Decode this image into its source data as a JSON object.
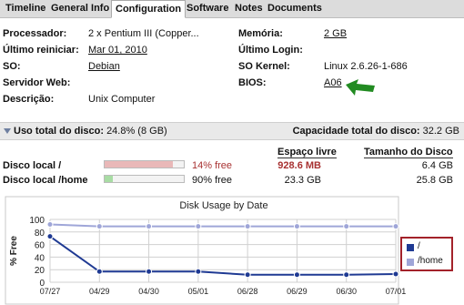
{
  "tabs": [
    {
      "label": "Timeline",
      "active": false
    },
    {
      "label": "General Info",
      "active": false
    },
    {
      "label": "Configuration",
      "active": true
    },
    {
      "label": "Software",
      "active": false
    },
    {
      "label": "Notes",
      "active": false
    },
    {
      "label": "Documents",
      "active": false
    }
  ],
  "info": {
    "processador_label": "Processador:",
    "processador_value": "2 x Pentium III (Copper...",
    "ultimo_reiniciar_label": "Último reiniciar:",
    "ultimo_reiniciar_value": "Mar 01, 2010",
    "so_label": "SO:",
    "so_value": "Debian",
    "servidor_web_label": "Servidor Web:",
    "servidor_web_value": "",
    "descricao_label": "Descrição:",
    "descricao_value": "Unix Computer",
    "memoria_label": "Memória:",
    "memoria_value": "2 GB",
    "ultimo_login_label": "Último Login:",
    "ultimo_login_value": "",
    "so_kernel_label": "SO Kernel:",
    "so_kernel_value": "Linux 2.6.26-1-686",
    "bios_label": "BIOS:",
    "bios_value": "A06"
  },
  "disk_section": {
    "title": "Uso total do disco:",
    "usage": "24.8% (8 GB)",
    "capacity_label": "Capacidade total do disco:",
    "capacity_value": "32.2 GB",
    "col_free": "Espaço livre",
    "col_size": "Tamanho do Disco",
    "disks": [
      {
        "name": "Disco local /",
        "pct_free": "14% free",
        "pct_fill": 0.86,
        "free_value": "928.6 MB",
        "size_value": "6.4 GB",
        "bar_color": "#e9b8b8",
        "pct_color": "#a83232"
      },
      {
        "name": "Disco local /home",
        "pct_free": "90% free",
        "pct_fill": 0.1,
        "free_value": "23.3 GB",
        "size_value": "25.8 GB",
        "bar_color": "#a8dca4",
        "pct_color": "#111111"
      }
    ]
  },
  "chart_data": {
    "type": "line",
    "title": "Disk Usage by Date",
    "ylabel": "% Free",
    "xlabel": "",
    "ylim": [
      0,
      100
    ],
    "yticks": [
      0,
      20,
      40,
      60,
      80,
      100
    ],
    "categories": [
      "07/27",
      "04/29",
      "04/30",
      "05/01",
      "06/28",
      "06/29",
      "06/30",
      "07/01"
    ],
    "series": [
      {
        "name": "/",
        "color": "#1f3a93",
        "values": [
          73,
          17,
          17,
          17,
          12,
          12,
          12,
          13
        ]
      },
      {
        "name": "/home",
        "color": "#9fa6d8",
        "values": [
          92,
          89,
          89,
          89,
          89,
          89,
          89,
          89
        ]
      }
    ],
    "grid": true,
    "legend": "right"
  },
  "colors": {
    "tab_bar": "#dcdcdc",
    "section_bar": "#e9e9e9",
    "accent_green": "#228b22",
    "legend_border": "#a3222a"
  },
  "icons": {
    "pointer": "green-arrow-icon",
    "collapse": "triangle-down-icon"
  }
}
